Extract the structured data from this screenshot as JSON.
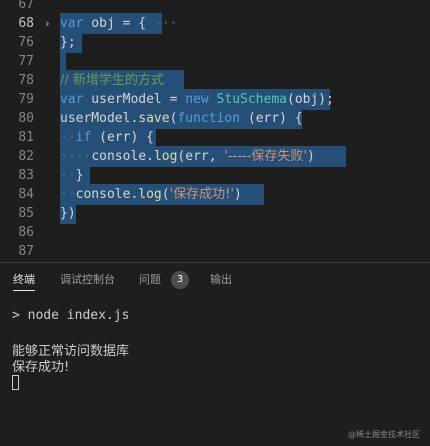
{
  "editor": {
    "line_numbers": [
      "67",
      "68",
      "76",
      "77",
      "78",
      "79",
      "80",
      "81",
      "82",
      "83",
      "84",
      "85",
      "86",
      "87"
    ],
    "l68": {
      "kw": "var",
      "rest": " obj = { ",
      "ellipsis": "···"
    },
    "l76": {
      "text": "};"
    },
    "l78": {
      "comment": "// 新增学生的方式"
    },
    "l79": {
      "kw": "var",
      "name": " userModel = ",
      "kw2": "new",
      "cls": " StuSchema",
      "rest": "(obj);"
    },
    "l80": {
      "pre": "userModel.",
      "fn": "save",
      "open": "(",
      "kw": "function",
      "rest": " (err) {"
    },
    "l81": {
      "indent": "··",
      "kw": "if",
      "rest": " (err) {"
    },
    "l82": {
      "indent": "····",
      "obj": "console.",
      "fn": "log",
      "args": "(err, ",
      "str": "'-----保存失败'",
      "close": ")"
    },
    "l83": {
      "indent": "··",
      "text": "}"
    },
    "l84": {
      "indent": "··",
      "obj": "console.",
      "fn": "log",
      "open": "(",
      "str": "'保存成功!'",
      "close": ")"
    },
    "l85": {
      "text": "})"
    }
  },
  "panel": {
    "tabs": [
      {
        "label": "终端",
        "active": true
      },
      {
        "label": "调试控制台",
        "active": false
      },
      {
        "label": "问题",
        "active": false
      },
      {
        "label": "输出",
        "active": false
      }
    ],
    "problems_count": "3",
    "terminal": {
      "command": "> node index.js",
      "output_1": "能够正常访问数据库",
      "output_2": "保存成功!"
    }
  },
  "watermark": "@稀土掘金技术社区",
  "colors": {
    "selection": "#264f78",
    "keyword": "#569cd6",
    "function": "#dcdcaa",
    "class": "#4ec9b0",
    "string": "#ce9178",
    "comment": "#6a9955"
  }
}
